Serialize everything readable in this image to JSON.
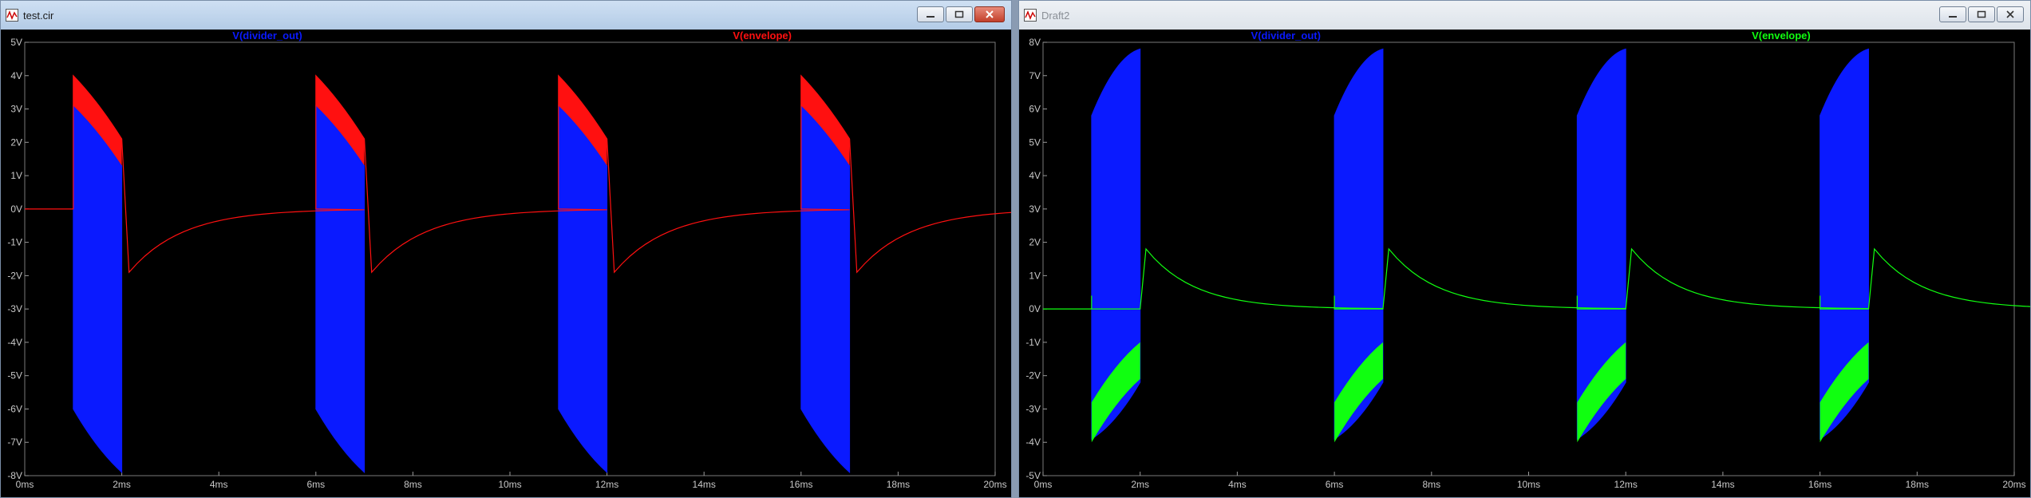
{
  "left_window": {
    "title": "test.cir",
    "icon": "ltspice-waveform-icon",
    "controls": [
      "minimize-icon",
      "maximize-icon",
      "close-icon"
    ]
  },
  "right_window": {
    "title": "Draft2",
    "icon": "ltspice-waveform-icon",
    "controls": [
      "minimize-icon",
      "maximize-icon",
      "close-icon"
    ]
  },
  "colors": {
    "background": "#000000",
    "grid": "#2e2e2e",
    "axis_text": "#c8c8c8",
    "blue": "#0a1aff",
    "red": "#ff1010",
    "green": "#10ff10"
  },
  "chart_data": [
    {
      "type": "line",
      "xlim": [
        0,
        20
      ],
      "ylim": [
        -8,
        5
      ],
      "x_ticks": [
        "0ms",
        "2ms",
        "4ms",
        "6ms",
        "8ms",
        "10ms",
        "12ms",
        "14ms",
        "16ms",
        "18ms",
        "20ms"
      ],
      "y_ticks": [
        "5V",
        "4V",
        "3V",
        "2V",
        "1V",
        "0V",
        "-1V",
        "-2V",
        "-3V",
        "-4V",
        "-5V",
        "-6V",
        "-7V",
        "-8V"
      ],
      "series": [
        {
          "name": "V(divider_out)",
          "color": "#0a1aff",
          "style": "dense-burst",
          "bursts": [
            {
              "start": 1,
              "end": 2
            },
            {
              "start": 6,
              "end": 7
            },
            {
              "start": 11,
              "end": 12
            },
            {
              "start": 16,
              "end": 17
            }
          ],
          "upper_start": 3.1,
          "upper_end": 1.3,
          "lower_start": -6.0,
          "lower_end": -7.9
        },
        {
          "name": "V(envelope)",
          "color": "#ff1010",
          "style": "envelope",
          "bursts": [
            {
              "start": 1,
              "end": 2
            },
            {
              "start": 6,
              "end": 7
            },
            {
              "start": 11,
              "end": 12
            },
            {
              "start": 16,
              "end": 17
            }
          ],
          "top_start": 4.0,
          "top_end": 2.1,
          "band_start": 3.1,
          "band_end": 1.3,
          "undershoot": -1.9,
          "baseline": 0
        }
      ]
    },
    {
      "type": "line",
      "xlim": [
        0,
        20
      ],
      "ylim": [
        -5,
        8
      ],
      "x_ticks": [
        "0ms",
        "2ms",
        "4ms",
        "6ms",
        "8ms",
        "10ms",
        "12ms",
        "14ms",
        "16ms",
        "18ms",
        "20ms"
      ],
      "y_ticks": [
        "8V",
        "7V",
        "6V",
        "5V",
        "4V",
        "3V",
        "2V",
        "1V",
        "0V",
        "-1V",
        "-2V",
        "-3V",
        "-4V",
        "-5V"
      ],
      "series": [
        {
          "name": "V(divider_out)",
          "color": "#0a1aff",
          "style": "dense-burst",
          "bursts": [
            {
              "start": 1,
              "end": 2
            },
            {
              "start": 6,
              "end": 7
            },
            {
              "start": 11,
              "end": 12
            },
            {
              "start": 16,
              "end": 17
            }
          ],
          "upper_start": 5.8,
          "upper_end": 7.8,
          "lower_start": -3.9,
          "lower_end": -2.2
        },
        {
          "name": "V(envelope)",
          "color": "#10ff10",
          "style": "envelope",
          "bursts": [
            {
              "start": 1,
              "end": 2
            },
            {
              "start": 6,
              "end": 7
            },
            {
              "start": 11,
              "end": 12
            },
            {
              "start": 16,
              "end": 17
            }
          ],
          "band_top_start": -2.8,
          "band_top_end": -1.0,
          "band_bottom_start": -4.0,
          "band_bottom_end": -2.1,
          "overshoot": 1.8,
          "baseline": 0
        }
      ]
    }
  ]
}
